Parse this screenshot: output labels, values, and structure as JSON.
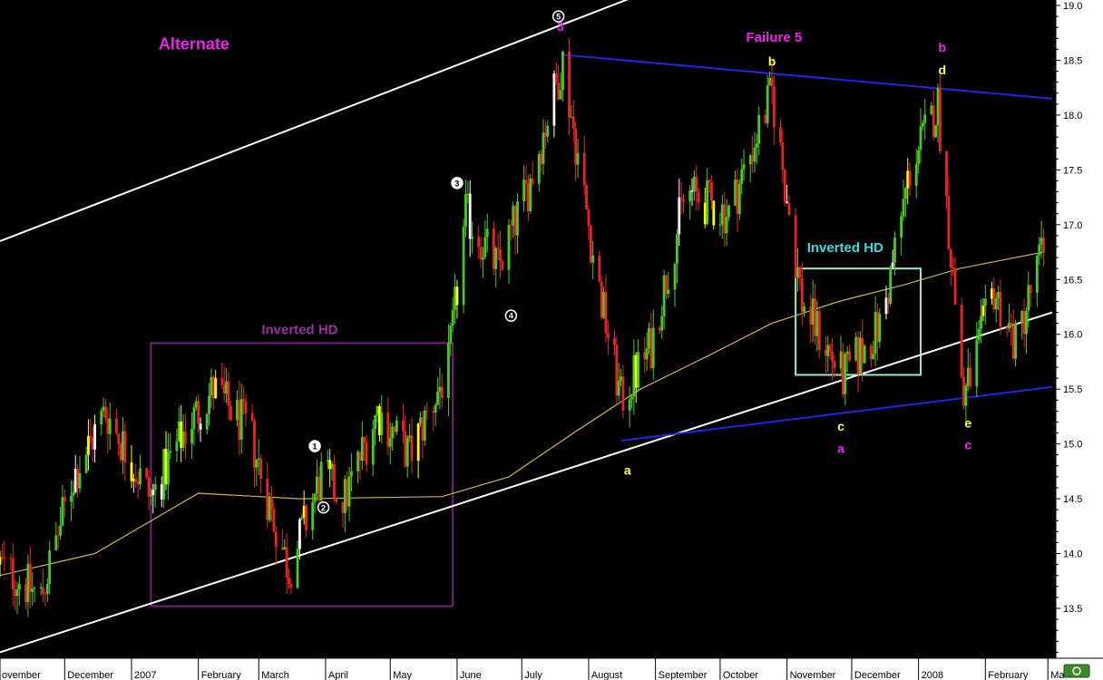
{
  "chart_data": {
    "type": "candlestick",
    "title": "",
    "xlabel": "",
    "ylabel": "",
    "ylim": [
      13.0,
      19.05
    ],
    "y_ticks": [
      "19.0",
      "18.5",
      "18.0",
      "17.5",
      "17.0",
      "16.5",
      "16.0",
      "15.5",
      "15.0",
      "14.5",
      "14.0",
      "13.5"
    ],
    "y_tick_values": [
      19.0,
      18.5,
      18.0,
      17.5,
      17.0,
      16.5,
      16.0,
      15.5,
      15.0,
      14.5,
      14.0,
      13.5
    ],
    "x_range_dates": [
      "2006-11-01",
      "2008-03-03"
    ],
    "month_labels": [
      {
        "text": "ovember",
        "date": "2006-11-01"
      },
      {
        "text": "December",
        "date": "2006-12-01"
      },
      {
        "text": "2007",
        "date": "2007-01-01"
      },
      {
        "text": "February",
        "date": "2007-02-01"
      },
      {
        "text": "March",
        "date": "2007-03-01"
      },
      {
        "text": "April",
        "date": "2007-04-01"
      },
      {
        "text": "May",
        "date": "2007-05-01"
      },
      {
        "text": "June",
        "date": "2007-06-01"
      },
      {
        "text": "July",
        "date": "2007-07-01"
      },
      {
        "text": "August",
        "date": "2007-08-01"
      },
      {
        "text": "September",
        "date": "2007-09-01"
      },
      {
        "text": "October",
        "date": "2007-10-01"
      },
      {
        "text": "November",
        "date": "2007-11-01"
      },
      {
        "text": "December",
        "date": "2007-12-01"
      },
      {
        "text": "2008",
        "date": "2008-01-01"
      },
      {
        "text": "February",
        "date": "2008-02-01"
      },
      {
        "text": "Ma",
        "date": "2008-03-01"
      }
    ],
    "price_path": [
      {
        "date": "2006-11-01",
        "close": 13.9
      },
      {
        "date": "2006-11-20",
        "close": 13.6
      },
      {
        "date": "2006-12-05",
        "close": 14.7
      },
      {
        "date": "2006-12-20",
        "close": 15.3
      },
      {
        "date": "2007-01-10",
        "close": 14.5
      },
      {
        "date": "2007-01-25",
        "close": 15.1
      },
      {
        "date": "2007-02-08",
        "close": 15.5
      },
      {
        "date": "2007-02-25",
        "close": 15.1
      },
      {
        "date": "2007-03-08",
        "close": 14.3
      },
      {
        "date": "2007-03-15",
        "close": 13.85
      },
      {
        "date": "2007-03-30",
        "close": 14.7
      },
      {
        "date": "2007-04-10",
        "close": 14.5
      },
      {
        "date": "2007-04-25",
        "close": 15.3
      },
      {
        "date": "2007-05-10",
        "close": 14.9
      },
      {
        "date": "2007-05-28",
        "close": 15.7
      },
      {
        "date": "2007-06-05",
        "close": 17.1
      },
      {
        "date": "2007-06-20",
        "close": 16.6
      },
      {
        "date": "2007-07-05",
        "close": 17.4
      },
      {
        "date": "2007-07-20",
        "close": 18.5
      },
      {
        "date": "2007-08-05",
        "close": 16.5
      },
      {
        "date": "2007-08-16",
        "close": 15.4
      },
      {
        "date": "2007-08-30",
        "close": 15.9
      },
      {
        "date": "2007-09-15",
        "close": 17.3
      },
      {
        "date": "2007-10-05",
        "close": 17.1
      },
      {
        "date": "2007-10-25",
        "close": 18.2
      },
      {
        "date": "2007-11-08",
        "close": 16.3
      },
      {
        "date": "2007-11-27",
        "close": 15.6
      },
      {
        "date": "2007-12-15",
        "close": 16.1
      },
      {
        "date": "2007-12-28",
        "close": 17.5
      },
      {
        "date": "2008-01-10",
        "close": 18.1
      },
      {
        "date": "2008-01-22",
        "close": 15.4
      },
      {
        "date": "2008-02-05",
        "close": 16.4
      },
      {
        "date": "2008-02-15",
        "close": 15.9
      },
      {
        "date": "2008-02-28",
        "close": 16.8
      }
    ],
    "moving_average": [
      {
        "date": "2006-11-01",
        "value": 13.8
      },
      {
        "date": "2006-12-15",
        "value": 14.0
      },
      {
        "date": "2007-02-01",
        "value": 14.55
      },
      {
        "date": "2007-03-20",
        "value": 14.5
      },
      {
        "date": "2007-05-25",
        "value": 14.52
      },
      {
        "date": "2007-06-25",
        "value": 14.7
      },
      {
        "date": "2007-07-25",
        "value": 15.1
      },
      {
        "date": "2007-08-25",
        "value": 15.5
      },
      {
        "date": "2007-09-25",
        "value": 15.8
      },
      {
        "date": "2007-10-25",
        "value": 16.1
      },
      {
        "date": "2007-11-25",
        "value": 16.3
      },
      {
        "date": "2007-12-25",
        "value": 16.45
      },
      {
        "date": "2008-01-20",
        "value": 16.6
      },
      {
        "date": "2008-02-28",
        "value": 16.75
      }
    ],
    "series": [
      {
        "name": "price",
        "colors": {
          "up": "#44cc22",
          "down": "#ee2222",
          "neutral": "#ffffff",
          "highlight": "#ffff00"
        }
      },
      {
        "name": "moving_average",
        "color": "#d4b24a"
      }
    ],
    "trend_lines": [
      {
        "color": "#ffffff",
        "points": [
          {
            "date": "2006-11-01",
            "value": 16.85
          },
          {
            "date": "2007-08-25",
            "value": 19.1
          }
        ]
      },
      {
        "color": "#ffffff",
        "points": [
          {
            "date": "2006-11-01",
            "value": 13.1
          },
          {
            "date": "2008-03-03",
            "value": 16.2
          }
        ]
      },
      {
        "color": "#2222ee",
        "points": [
          {
            "date": "2007-07-20",
            "value": 18.55
          },
          {
            "date": "2008-03-03",
            "value": 18.15
          }
        ]
      },
      {
        "color": "#2222ee",
        "points": [
          {
            "date": "2007-08-16",
            "value": 15.03
          },
          {
            "date": "2008-03-03",
            "value": 15.52
          }
        ]
      }
    ],
    "boxes": [
      {
        "label": "Inverted HD",
        "color": "#7a1f7f",
        "from": "2007-01-10",
        "to": "2007-05-30",
        "low": 13.52,
        "high": 15.92
      },
      {
        "label": "Inverted HD",
        "color": "#99eebb",
        "from": "2007-11-05",
        "to": "2008-01-02",
        "low": 15.63,
        "high": 16.6
      }
    ],
    "annotations": [
      {
        "text": "Alternate",
        "color": "#ee22ee",
        "date": "2007-01-30",
        "value": 18.6
      },
      {
        "text": "Inverted HD",
        "color": "#9b2fa0",
        "date": "2007-03-20",
        "value": 16.0
      },
      {
        "text": "Inverted HD",
        "color": "#33dddd",
        "date": "2007-11-28",
        "value": 16.75
      },
      {
        "text": "Failure 5",
        "color": "#ee22ee",
        "date": "2007-10-26",
        "value": 18.67
      },
      {
        "text": "3",
        "color": "#ee22ee",
        "date": "2007-07-19",
        "value": 18.77
      },
      {
        "text": "b",
        "color": "#ffff44",
        "date": "2007-10-25",
        "value": 18.45
      },
      {
        "text": "b",
        "color": "#ee22ee",
        "date": "2008-01-12",
        "value": 18.58
      },
      {
        "text": "d",
        "color": "#ffff44",
        "date": "2008-01-12",
        "value": 18.37
      },
      {
        "text": "a",
        "color": "#ffff44",
        "date": "2007-08-19",
        "value": 14.72
      },
      {
        "text": "c",
        "color": "#ffff44",
        "date": "2007-11-26",
        "value": 15.12
      },
      {
        "text": "a",
        "color": "#ee22ee",
        "date": "2007-11-26",
        "value": 14.92
      },
      {
        "text": "e",
        "color": "#ffff44",
        "date": "2008-01-24",
        "value": 15.15
      },
      {
        "text": "c",
        "color": "#ee22ee",
        "date": "2008-01-24",
        "value": 14.95
      }
    ],
    "wave_markers": [
      {
        "text": "1",
        "style": "white",
        "date": "2007-03-27",
        "value": 14.98
      },
      {
        "text": "2",
        "style": "black",
        "date": "2007-03-31",
        "value": 14.42
      },
      {
        "text": "3",
        "style": "white",
        "date": "2007-06-01",
        "value": 17.38
      },
      {
        "text": "4",
        "style": "black",
        "date": "2007-06-26",
        "value": 16.17
      },
      {
        "text": "5",
        "style": "black",
        "date": "2007-07-18",
        "value": 18.9
      }
    ],
    "grid": false,
    "legend": "none"
  }
}
